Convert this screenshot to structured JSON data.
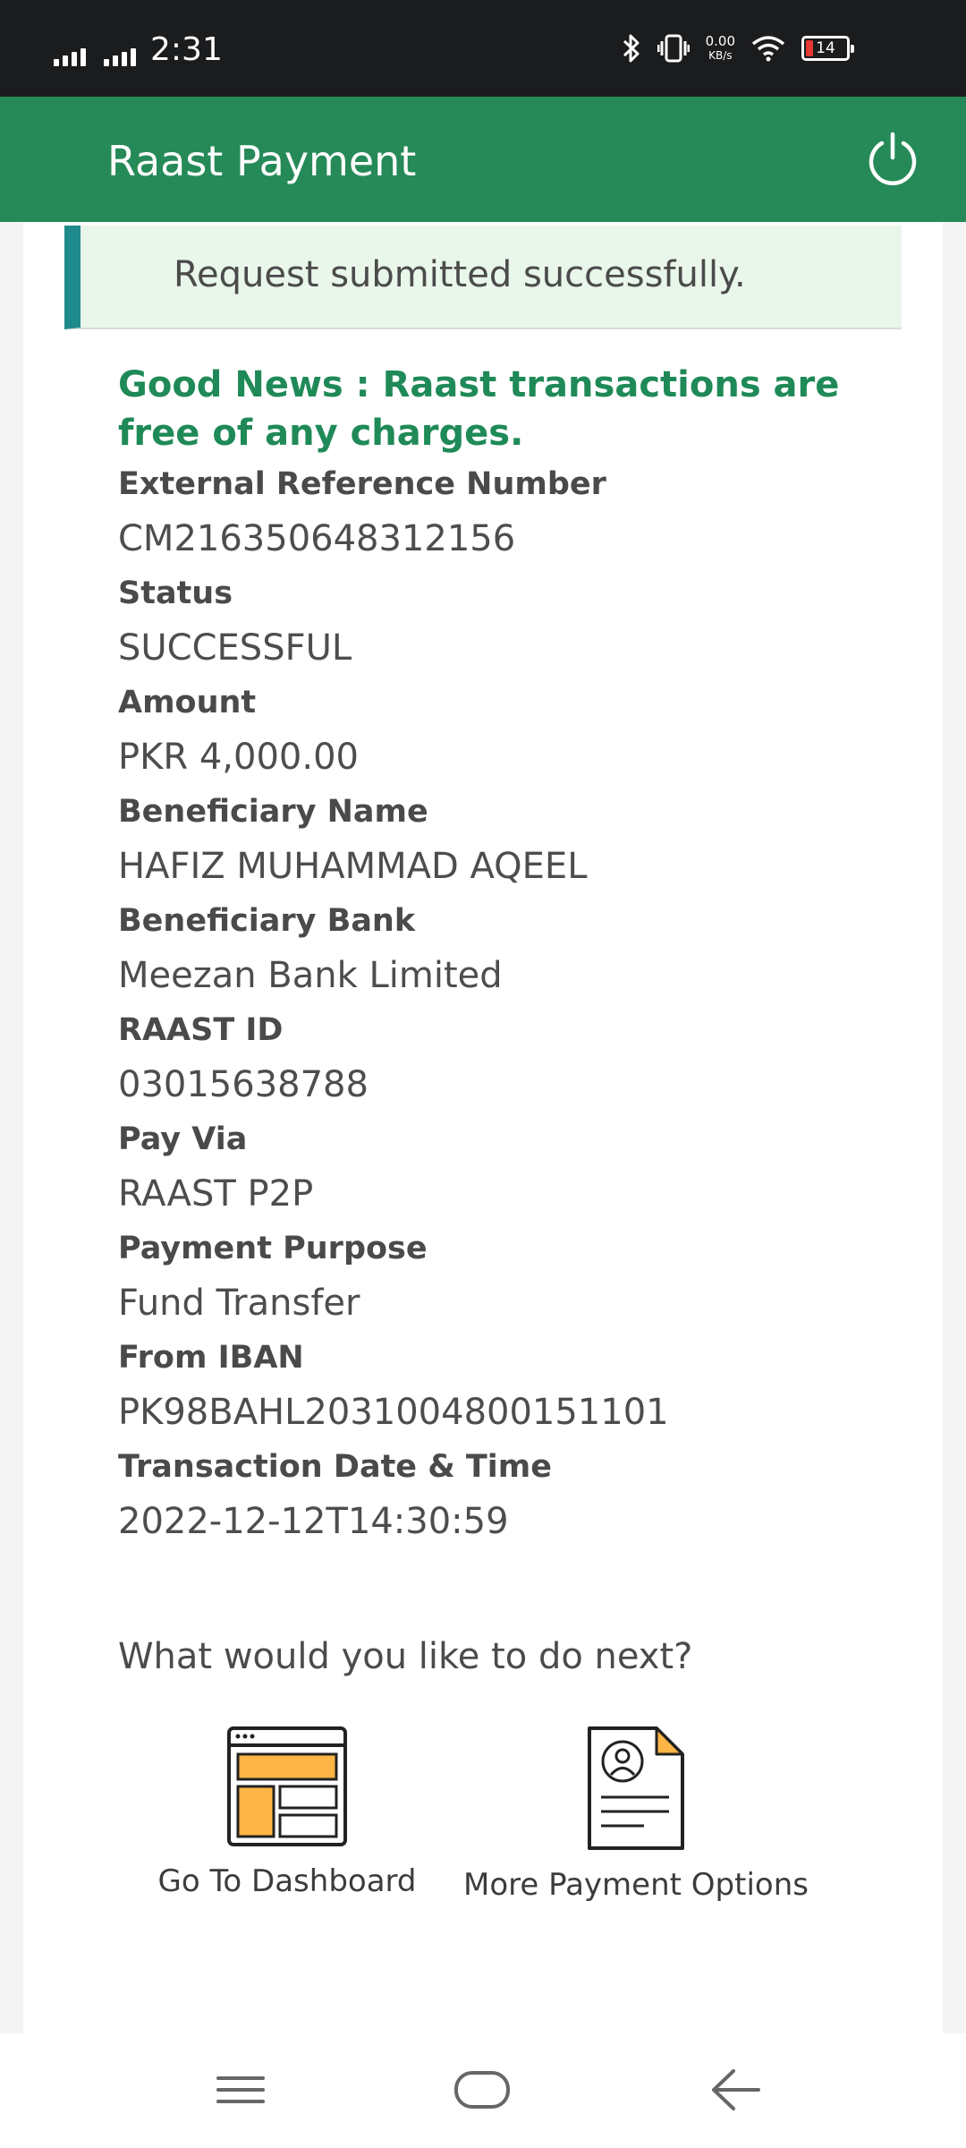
{
  "status_bar": {
    "time": "2:31",
    "net_speed": "0.00",
    "net_unit": "KB/s",
    "battery": "14",
    "icons": [
      "signal-icon",
      "bluetooth-icon",
      "vibrate-icon",
      "wifi-icon",
      "battery-icon"
    ]
  },
  "app_bar": {
    "title": "Raast Payment",
    "power_icon": "power-icon"
  },
  "banner": {
    "message": "Request submitted successfully."
  },
  "good_news": "Good News : Raast transactions are free of any charges.",
  "details": [
    {
      "label": "External Reference Number",
      "value": "CM216350648312156"
    },
    {
      "label": "Status",
      "value": "SUCCESSFUL"
    },
    {
      "label": "Amount",
      "value": "PKR 4,000.00"
    },
    {
      "label": "Beneficiary Name",
      "value": "HAFIZ MUHAMMAD AQEEL"
    },
    {
      "label": "Beneficiary Bank",
      "value": "Meezan Bank Limited"
    },
    {
      "label": "RAAST ID",
      "value": "03015638788"
    },
    {
      "label": "Pay Via",
      "value": "RAAST P2P"
    },
    {
      "label": "Payment Purpose",
      "value": "Fund Transfer"
    },
    {
      "label": "From IBAN",
      "value": "PK98BAHL2031004800151101"
    },
    {
      "label": "Transaction Date & Time",
      "value": "2022-12-12T14:30:59"
    }
  ],
  "next": {
    "question": "What would you like to do next?",
    "actions": [
      {
        "label": "Go To Dashboard",
        "icon": "dashboard-icon"
      },
      {
        "label": "More Payment Options",
        "icon": "document-icon"
      }
    ]
  },
  "colors": {
    "header_green": "#258a57",
    "accent_green": "#1f8a57",
    "banner_bg": "#e9f6ea",
    "banner_border": "#1f8a8b",
    "icon_orange": "#ffb545"
  },
  "nav_bar": {
    "icons": [
      "menu-icon",
      "home-icon",
      "back-icon"
    ]
  }
}
